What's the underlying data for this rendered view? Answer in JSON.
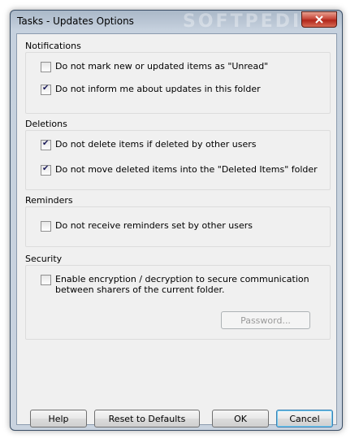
{
  "window": {
    "title": "Tasks - Updates Options",
    "watermark": "SOFTPEDIA"
  },
  "notifications": {
    "title": "Notifications",
    "items": [
      {
        "label": "Do not mark new or updated items as \"Unread\"",
        "checked": false
      },
      {
        "label": "Do not inform me about updates in this folder",
        "checked": true
      }
    ]
  },
  "deletions": {
    "title": "Deletions",
    "items": [
      {
        "label": "Do not delete items if deleted by other users",
        "checked": true
      },
      {
        "label": "Do not move deleted items into the \"Deleted Items\" folder",
        "checked": true
      }
    ]
  },
  "reminders": {
    "title": "Reminders",
    "items": [
      {
        "label": "Do not receive reminders set by other users",
        "checked": false
      }
    ]
  },
  "security": {
    "title": "Security",
    "encryption_label": "Enable encryption / decryption to secure communication between sharers of the current folder.",
    "encryption_checked": false,
    "password_button": "Password..."
  },
  "buttons": {
    "help": "Help",
    "reset": "Reset to Defaults",
    "ok": "OK",
    "cancel": "Cancel"
  },
  "icons": {
    "close": "close-icon"
  }
}
